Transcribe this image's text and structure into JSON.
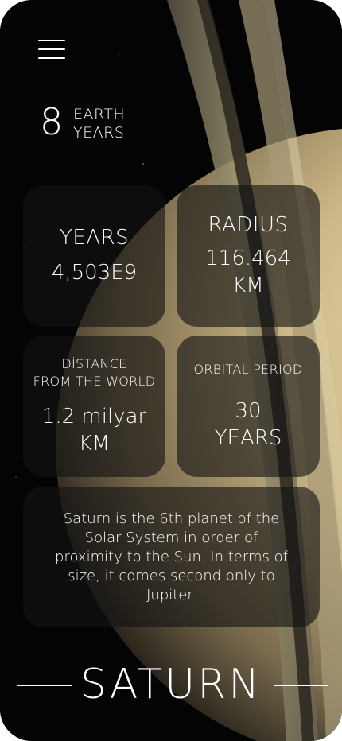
{
  "header": {
    "menu_icon": "hamburger-menu-icon",
    "years_number": "8",
    "years_label_1": "EARTH",
    "years_label_2": "YEARS"
  },
  "cards": {
    "years": {
      "title": "YEARS",
      "value": "4,503E9"
    },
    "radius": {
      "title": "RADIUS",
      "value_1": "116.464",
      "value_2": "KM"
    },
    "distance": {
      "title_1": "DİSTANCE",
      "title_2": "FROM THE WORLD",
      "value_1": "1.2 milyar",
      "value_2": "KM"
    },
    "orbital": {
      "title": "ORBİTAL PERİOD",
      "value_1": "30",
      "value_2": "YEARS"
    },
    "description": {
      "line_1": "Saturn is the 6th planet of the",
      "line_2": "Solar System in order of",
      "line_3": "proximity to the Sun. In terms of",
      "line_4": "size, it comes second only to",
      "line_5": "Jupiter."
    }
  },
  "footer": {
    "planet_name": "SATURN"
  },
  "colors": {
    "background": "#000000",
    "card": "#141414",
    "text": "#ffffff",
    "planet": "#cbb88a"
  }
}
